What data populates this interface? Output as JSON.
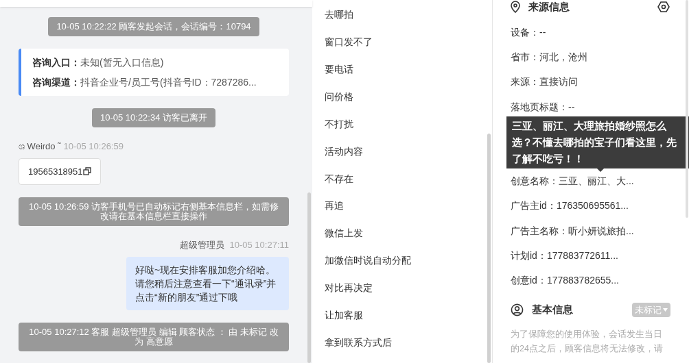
{
  "chat": {
    "messages": [
      {
        "kind": "system",
        "text": "10-05 10:22:22 顾客发起会话，会话编号：10794"
      },
      {
        "kind": "entry_card",
        "rows": [
          {
            "label": "咨询入口：",
            "value": "未知(暂无入口信息)"
          },
          {
            "label": "咨询渠道：",
            "value": "抖音企业号/员工号(抖音号ID：7287286..."
          }
        ]
      },
      {
        "kind": "system",
        "text": "10-05 10:22:34 访客已离开"
      },
      {
        "kind": "visitor",
        "sender": "ශ Weirdo ˜",
        "time": "10-05 10:26:59",
        "text": "19565318951"
      },
      {
        "kind": "system",
        "text": "10-05 10:26:59 访客手机号已自动标记右侧基本信息栏，如需修改请在基本信息栏直接操作"
      },
      {
        "kind": "agent",
        "sender": "超级管理员",
        "time": "10-05 10:27:11",
        "text": "好哒~现在安排客服加您介绍哈。请您稍后注意查看一下“通讯录”并点击“新的朋友”通过下哦"
      },
      {
        "kind": "system",
        "text": "10-05 10:27:12 客服 超级管理员 编辑 顾客状态 ： 由 未标记 改为 高意愿"
      }
    ]
  },
  "quick_replies": [
    "去哪拍",
    "窗口发不了",
    "要电话",
    "问价格",
    "不打扰",
    "活动内容",
    "不存在",
    "再追",
    "微信上发",
    "加微信时说自动分配",
    "对比再决定",
    "让加客服",
    "拿到联系方式后"
  ],
  "source_info": {
    "title": "来源信息",
    "rows": [
      "设备：--",
      "省市：河北，沧州",
      "来源：直接访问",
      "落地页标题：--",
      "创意名称：三亚、丽江、大...",
      "广告主id：176350695561...",
      "广告主名称：听小妍说旅拍...",
      "计划id：177883772611...",
      "创意id：177883782655..."
    ],
    "tooltip": "三亚、丽江、大理旅拍婚纱照怎么选？不懂去哪拍的宝子们看这里，先了解不吃亏！！"
  },
  "basic_info": {
    "title": "基本信息",
    "status": "未标记",
    "note": "为了保障您的使用体验，会话发生当日的24点之后，顾客信息将无法修改，请"
  }
}
